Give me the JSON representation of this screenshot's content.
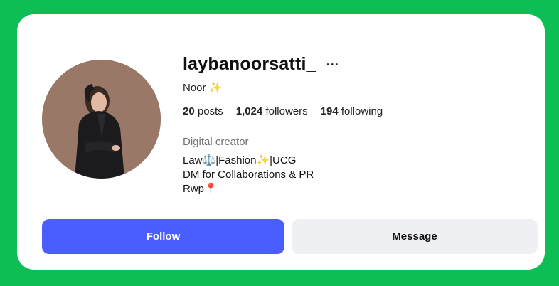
{
  "profile": {
    "username": "laybanoorsatti_",
    "more_glyph": "···",
    "display_name": "Noor ✨",
    "stats": {
      "posts_count": "20",
      "posts_label": "posts",
      "followers_count": "1,024",
      "followers_label": "followers",
      "following_count": "194",
      "following_label": "following"
    },
    "category": "Digital creator",
    "bio": [
      "Law⚖️|Fashion✨|UCG",
      "DM for Collaborations & PR",
      "Rwp📍"
    ]
  },
  "actions": {
    "follow_label": "Follow",
    "message_label": "Message"
  },
  "colors": {
    "page_background": "#0dbe54",
    "card_background": "#ffffff",
    "follow_button": "#4a5dff",
    "message_button": "#eff0f4"
  }
}
